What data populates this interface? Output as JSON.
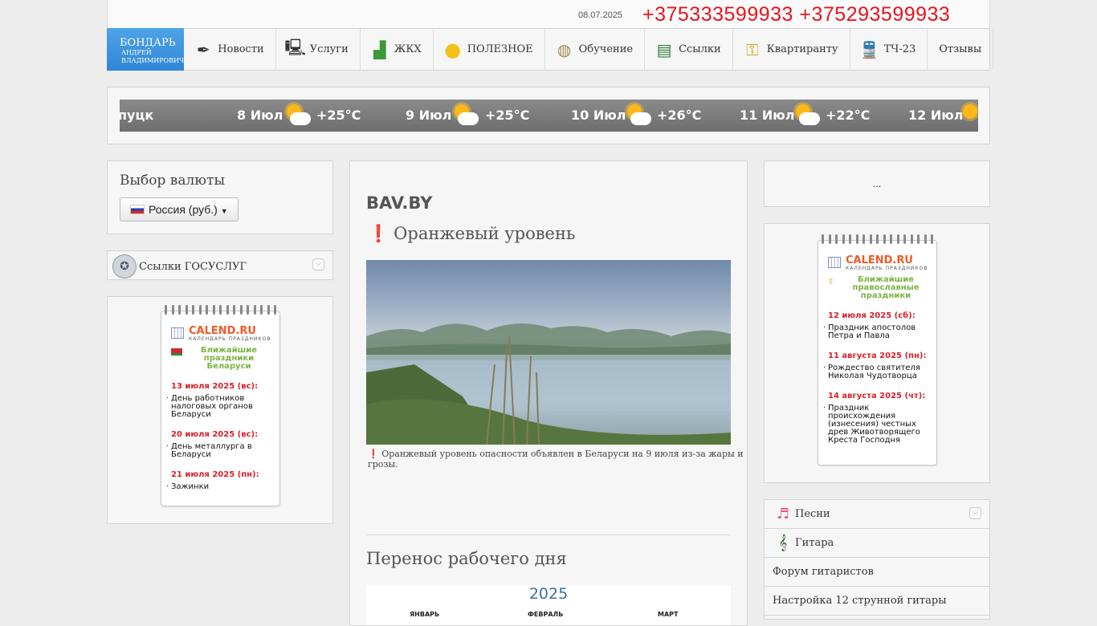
{
  "header": {
    "date": "08.07.2025",
    "phones": "+375333599933 +375293599933"
  },
  "brand": {
    "name": "БОНДАРЬ",
    "subname": "АНДРЕЙ ВЛАДИМИРОВИЧ"
  },
  "nav": [
    {
      "label": "Новости",
      "icon": "pen-icon"
    },
    {
      "label": "Услуги",
      "icon": "computer-icon"
    },
    {
      "label": "ЖКХ",
      "icon": "chart-icon"
    },
    {
      "label": "ПОЛЕЗНОЕ",
      "icon": "lightbulb-icon"
    },
    {
      "label": "Обучение",
      "icon": "globe-icon"
    },
    {
      "label": "Ссылки",
      "icon": "books-icon"
    },
    {
      "label": "Квартиранту",
      "icon": "key-icon"
    },
    {
      "label": "ТЧ-23",
      "icon": "train-icon"
    },
    {
      "label": "Отзывы",
      "icon": ""
    }
  ],
  "weather": {
    "city": "пуцк",
    "days": [
      {
        "date": "8 Июл",
        "temp": "+25°C"
      },
      {
        "date": "9 Июл",
        "temp": "+25°C"
      },
      {
        "date": "10 Июл",
        "temp": "+26°C"
      },
      {
        "date": "11 Июл",
        "temp": "+22°C"
      },
      {
        "date": "12 Июл",
        "temp": ""
      }
    ]
  },
  "currency": {
    "title": "Выбор валюты",
    "selected": "Россия (руб.)"
  },
  "gosuslugi": {
    "label": "Ссылки ГОСУСЛУГ"
  },
  "calendar_left": {
    "logo": "CALEND.RU",
    "logo_sub": "КАЛЕНДАРЬ ПРАЗДНИКОВ",
    "subtitle": "Ближайшие праздники Беларуси",
    "events": [
      {
        "date": "13 июля 2025 (вс):",
        "text": "День работников налоговых органов Беларуси"
      },
      {
        "date": "20 июля 2025 (вс):",
        "text": "День металлурга в Беларуси"
      },
      {
        "date": "21 июля 2025 (пн):",
        "text": "Зажинки"
      }
    ]
  },
  "main": {
    "site": "BAV.BY",
    "article_title": "Оранжевый уровень",
    "exclaim": "❗",
    "caption": "Оранжевый уровень опасности объявлен в Беларуси на 9 июля из-за жары и грозы.",
    "section_title": "Перенос рабочего дня",
    "calendar_year": "2025",
    "months": [
      "ЯНВАРЬ",
      "ФЕВРАЛЬ",
      "МАРТ"
    ]
  },
  "right_box": {
    "text": "..."
  },
  "calendar_right": {
    "logo": "CALEND.RU",
    "logo_sub": "КАЛЕНДАРЬ ПРАЗДНИКОВ",
    "subtitle": "Ближайшие православные праздники",
    "events": [
      {
        "date": "12 июля 2025 (сб):",
        "text": "Праздник апостолов Петра и Павла"
      },
      {
        "date": "11 августа 2025 (пн):",
        "text": "Рождество святителя Николая Чудотворца"
      },
      {
        "date": "14 августа 2025 (чт):",
        "text": "Праздник происхождения (изнесения) честных древ Животворящего Креста Господня"
      }
    ]
  },
  "links": [
    {
      "label": "Песни",
      "icon": "music-icon"
    },
    {
      "label": "Гитара",
      "icon": "guitar-icon"
    },
    {
      "label": "Форум гитаристов",
      "icon": ""
    },
    {
      "label": "Настройка 12 струнной гитары",
      "icon": ""
    }
  ]
}
